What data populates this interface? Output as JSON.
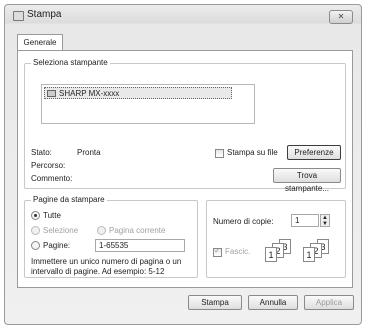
{
  "window": {
    "title": "Stampa",
    "close_label": "✕"
  },
  "tab": {
    "label": "Generale"
  },
  "printer_group": {
    "title": "Seleziona stampante",
    "selected_printer": "SHARP MX-xxxx",
    "status_label": "Stato:",
    "status_value": "Pronta",
    "path_label": "Percorso:",
    "comment_label": "Commento:",
    "print_to_file_label": "Stampa su file",
    "preferences_label": "Preferenze",
    "find_printer_label": "Trova stampante..."
  },
  "page_range": {
    "title": "Pagine da stampare",
    "all_label": "Tutte",
    "selection_label": "Selezione",
    "current_page_label": "Pagina corrente",
    "pages_label": "Pagine:",
    "pages_value": "1-65535",
    "help_text_1": "Immettere un unico numero di pagina o un",
    "help_text_2": "intervallo di pagine. Ad esempio: 5-12"
  },
  "copies": {
    "copies_label": "Numero di copie:",
    "copies_value": "1",
    "collate_label": "Fascic."
  },
  "footer": {
    "print_label": "Stampa",
    "cancel_label": "Annulla",
    "apply_label": "Applica"
  },
  "icons": {
    "printer": "printer-icon",
    "close": "close-icon",
    "spin": "spin-updown-icon"
  }
}
